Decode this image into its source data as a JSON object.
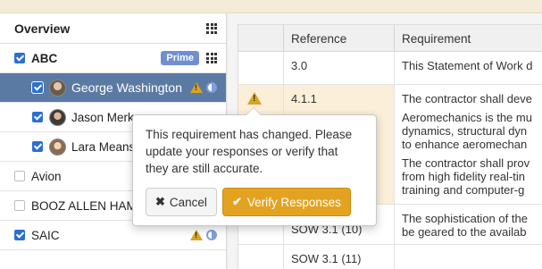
{
  "sidebar": {
    "title": "Overview",
    "items": [
      {
        "label": "ABC",
        "badge": "Prime"
      },
      {
        "label": "George Washington"
      },
      {
        "label": "Jason Merk"
      },
      {
        "label": "Lara Means"
      },
      {
        "label": "Avion"
      },
      {
        "label": "BOOZ ALLEN HAM"
      },
      {
        "label": "SAIC"
      }
    ]
  },
  "table": {
    "headers": [
      "",
      "Reference",
      "Requirement"
    ],
    "rows": [
      {
        "reference": "3.0",
        "requirement": [
          "This Statement of Work d"
        ]
      },
      {
        "reference": "4.1.1",
        "requirement": [
          "The contractor shall deve",
          "Aeromechanics is the mu",
          "dynamics, structural dyn",
          "to enhance aeromechan",
          "The contractor shall prov",
          "from high fidelity real-tin",
          "training and computer-g"
        ]
      },
      {
        "reference": "SOW 3.1 (10)",
        "requirement": [
          "The sophistication of the",
          "be geared to the availab"
        ]
      },
      {
        "reference": "SOW 3.1 (11)",
        "requirement": [
          ""
        ]
      }
    ]
  },
  "popover": {
    "message": "This requirement has changed. Please update your responses or verify that they are still accurate.",
    "cancel_label": "Cancel",
    "verify_label": "Verify Responses"
  },
  "colors": {
    "warning": "#d9a323",
    "selected_row": "#5b7aa3",
    "verify_button": "#e3a321",
    "checkbox": "#2a6fd6"
  }
}
